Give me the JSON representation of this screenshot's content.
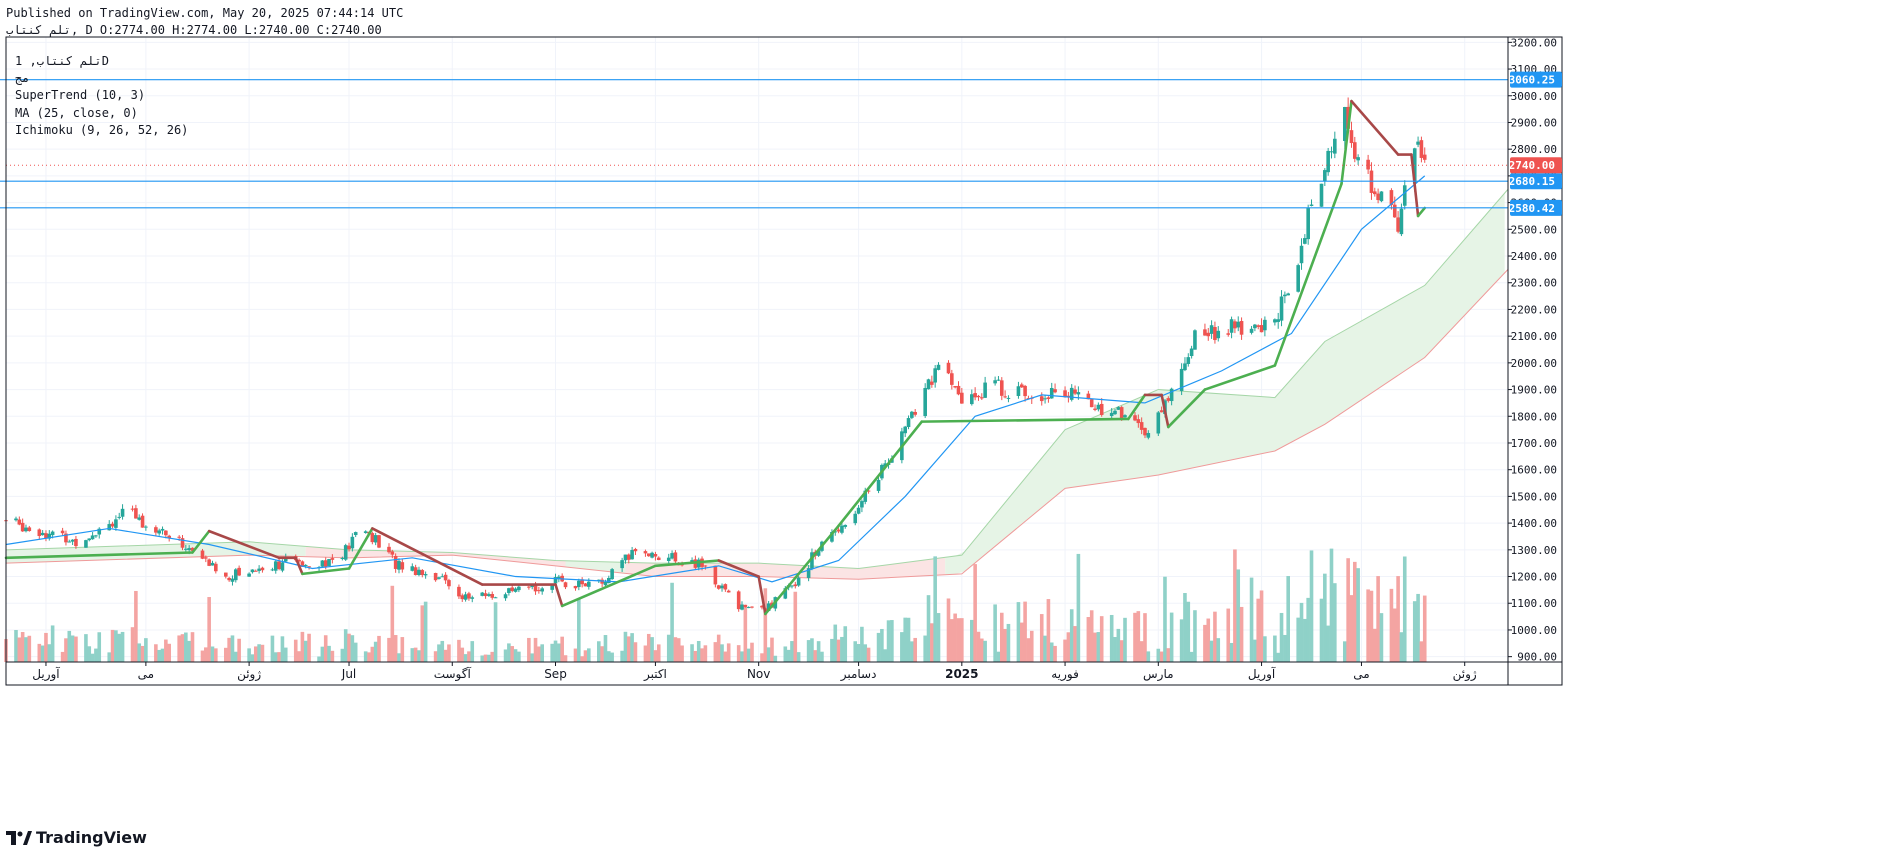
{
  "header": {
    "published": "Published on TradingView.com, May 20, 2025 07:44:14 UTC",
    "ohlc_line": "تلم کنتاب, D O:2774.00 H:2774.00 L:2740.00 C:2740.00"
  },
  "legend": {
    "symbol": "تلم کنتاب, 1D",
    "line2": "مج",
    "supertrend": "SuperTrend (10, 3)",
    "ma": "MA (25, close, 0)",
    "ichimoku": "Ichimoku (9, 26, 52, 26)"
  },
  "footer": {
    "brand": "TradingView"
  },
  "colors": {
    "up": "#26a69a",
    "down": "#ef5350",
    "up_vol": "#8fd1c8",
    "down_vol": "#f4a4a2",
    "supertrend_up": "#4caf50",
    "supertrend_down": "#a84848",
    "ma": "#2196f3",
    "cloud_green": "#e6f4e6",
    "cloud_red": "#fbe4e4",
    "hline": "#2196f3",
    "grid": "#f0f3fa"
  },
  "chart_data": {
    "type": "candlestick",
    "y_axis": {
      "ticks": [
        "3200.00",
        "3100.00",
        "3000.00",
        "2900.00",
        "2800.00",
        "2700.00",
        "2600.00",
        "2500.00",
        "2400.00",
        "2300.00",
        "2200.00",
        "2100.00",
        "2000.00",
        "1900.00",
        "1800.00",
        "1700.00",
        "1600.00",
        "1500.00",
        "1400.00",
        "1300.00",
        "1200.00",
        "1100.00",
        "1000.00",
        "900.00"
      ],
      "range": [
        880,
        3220
      ]
    },
    "x_axis": {
      "labels": [
        "آوریل",
        "می",
        "ژوئن",
        "Jul",
        "آگوست",
        "Sep",
        "اکتبر",
        "Nov",
        "دسامبر",
        "2025",
        "فوریه",
        "مارس",
        "آوریل",
        "می",
        "ژوئن"
      ],
      "label_dates": [
        "2024-04-01",
        "2024-05-01",
        "2024-06-01",
        "2024-07-01",
        "2024-08-01",
        "2024-09-01",
        "2024-10-01",
        "2024-11-01",
        "2024-12-01",
        "2025-01-01",
        "2025-02-01",
        "2025-03-01",
        "2025-04-01",
        "2025-05-01",
        "2025-06-01"
      ],
      "date_range": [
        "2024-03-20",
        "2025-06-14"
      ]
    },
    "price_lines": [
      {
        "value": 3060.25,
        "label": "3060.25"
      },
      {
        "value": 2680.15,
        "label": "2680.15"
      },
      {
        "value": 2580.42,
        "label": "2580.42"
      }
    ],
    "last_price": {
      "value": 2740.0,
      "label": "2740.00"
    },
    "price_path": [
      [
        "2024-03-20",
        1410
      ],
      [
        "2024-04-10",
        1330
      ],
      [
        "2024-04-25",
        1440
      ],
      [
        "2024-05-10",
        1340
      ],
      [
        "2024-05-25",
        1200
      ],
      [
        "2024-06-10",
        1250
      ],
      [
        "2024-06-28",
        1260
      ],
      [
        "2024-07-05",
        1390
      ],
      [
        "2024-07-15",
        1250
      ],
      [
        "2024-07-28",
        1200
      ],
      [
        "2024-08-05",
        1120
      ],
      [
        "2024-08-20",
        1140
      ],
      [
        "2024-09-01",
        1180
      ],
      [
        "2024-09-15",
        1170
      ],
      [
        "2024-09-25",
        1300
      ],
      [
        "2024-10-05",
        1270
      ],
      [
        "2024-10-15",
        1240
      ],
      [
        "2024-10-25",
        1100
      ],
      [
        "2024-11-02",
        1070
      ],
      [
        "2024-11-10",
        1150
      ],
      [
        "2024-11-20",
        1320
      ],
      [
        "2024-11-30",
        1450
      ],
      [
        "2024-12-10",
        1640
      ],
      [
        "2024-12-18",
        1820
      ],
      [
        "2024-12-25",
        2000
      ],
      [
        "2025-01-01",
        1850
      ],
      [
        "2025-01-10",
        1920
      ],
      [
        "2025-01-20",
        1880
      ],
      [
        "2025-01-30",
        1900
      ],
      [
        "2025-02-10",
        1840
      ],
      [
        "2025-02-20",
        1800
      ],
      [
        "2025-02-27",
        1730
      ],
      [
        "2025-03-05",
        1900
      ],
      [
        "2025-03-12",
        2100
      ],
      [
        "2025-03-20",
        2130
      ],
      [
        "2025-04-01",
        2120
      ],
      [
        "2025-04-08",
        2230
      ],
      [
        "2025-04-15",
        2540
      ],
      [
        "2025-04-20",
        2700
      ],
      [
        "2025-04-25",
        2980
      ],
      [
        "2025-05-01",
        2700
      ],
      [
        "2025-05-08",
        2620
      ],
      [
        "2025-05-12",
        2500
      ],
      [
        "2025-05-16",
        2830
      ],
      [
        "2025-05-20",
        2740
      ]
    ],
    "supertrend": [
      [
        "2024-03-20",
        1270,
        "up"
      ],
      [
        "2024-05-15",
        1290,
        "up"
      ],
      [
        "2024-05-20",
        1370,
        "down"
      ],
      [
        "2024-06-10",
        1270,
        "down"
      ],
      [
        "2024-06-15",
        1270,
        "down"
      ],
      [
        "2024-06-17",
        1210,
        "up"
      ],
      [
        "2024-07-01",
        1230,
        "up"
      ],
      [
        "2024-07-08",
        1380,
        "down"
      ],
      [
        "2024-08-10",
        1170,
        "down"
      ],
      [
        "2024-09-01",
        1170,
        "down"
      ],
      [
        "2024-09-03",
        1090,
        "up"
      ],
      [
        "2024-10-01",
        1240,
        "up"
      ],
      [
        "2024-10-20",
        1260,
        "down"
      ],
      [
        "2024-11-01",
        1200,
        "down"
      ],
      [
        "2024-11-03",
        1060,
        "up"
      ],
      [
        "2024-11-25",
        1390,
        "up"
      ],
      [
        "2024-12-20",
        1780,
        "up"
      ],
      [
        "2025-02-20",
        1790,
        "up"
      ],
      [
        "2025-02-25",
        1880,
        "down"
      ],
      [
        "2025-03-02",
        1880,
        "down"
      ],
      [
        "2025-03-04",
        1760,
        "up"
      ],
      [
        "2025-03-15",
        1900,
        "up"
      ],
      [
        "2025-04-05",
        1990,
        "up"
      ],
      [
        "2025-04-25",
        2670,
        "up"
      ],
      [
        "2025-04-28",
        2980,
        "down"
      ],
      [
        "2025-05-12",
        2780,
        "down"
      ],
      [
        "2025-05-16",
        2780,
        "down"
      ],
      [
        "2025-05-18",
        2550,
        "up"
      ],
      [
        "2025-05-20",
        2580,
        "up"
      ]
    ],
    "ma": [
      [
        "2024-03-20",
        1320
      ],
      [
        "2024-04-20",
        1380
      ],
      [
        "2024-05-20",
        1320
      ],
      [
        "2024-06-20",
        1230
      ],
      [
        "2024-07-20",
        1270
      ],
      [
        "2024-08-20",
        1200
      ],
      [
        "2024-09-20",
        1180
      ],
      [
        "2024-10-20",
        1240
      ],
      [
        "2024-11-05",
        1180
      ],
      [
        "2024-11-25",
        1260
      ],
      [
        "2024-12-15",
        1500
      ],
      [
        "2025-01-05",
        1800
      ],
      [
        "2025-01-25",
        1880
      ],
      [
        "2025-02-25",
        1850
      ],
      [
        "2025-03-20",
        1970
      ],
      [
        "2025-04-10",
        2110
      ],
      [
        "2025-05-01",
        2500
      ],
      [
        "2025-05-20",
        2700
      ]
    ],
    "cloud_top": [
      [
        "2024-03-20",
        1300
      ],
      [
        "2024-06-01",
        1330
      ],
      [
        "2024-07-01",
        1300
      ],
      [
        "2024-08-01",
        1290
      ],
      [
        "2024-09-01",
        1260
      ],
      [
        "2024-10-01",
        1250
      ],
      [
        "2024-11-01",
        1250
      ],
      [
        "2024-12-01",
        1230
      ],
      [
        "2025-01-01",
        1280
      ],
      [
        "2025-02-01",
        1750
      ],
      [
        "2025-03-01",
        1900
      ],
      [
        "2025-04-05",
        1870
      ],
      [
        "2025-04-20",
        2080
      ],
      [
        "2025-05-20",
        2290
      ],
      [
        "2025-06-14",
        2650
      ]
    ],
    "cloud_bottom": [
      [
        "2024-03-20",
        1250
      ],
      [
        "2024-06-01",
        1280
      ],
      [
        "2024-07-01",
        1270
      ],
      [
        "2024-08-01",
        1280
      ],
      [
        "2024-09-01",
        1240
      ],
      [
        "2024-10-01",
        1200
      ],
      [
        "2024-11-01",
        1200
      ],
      [
        "2024-12-01",
        1190
      ],
      [
        "2025-01-01",
        1210
      ],
      [
        "2025-02-01",
        1530
      ],
      [
        "2025-03-01",
        1580
      ],
      [
        "2025-04-05",
        1670
      ],
      [
        "2025-04-20",
        1770
      ],
      [
        "2025-05-20",
        2020
      ],
      [
        "2025-06-14",
        2350
      ]
    ]
  }
}
